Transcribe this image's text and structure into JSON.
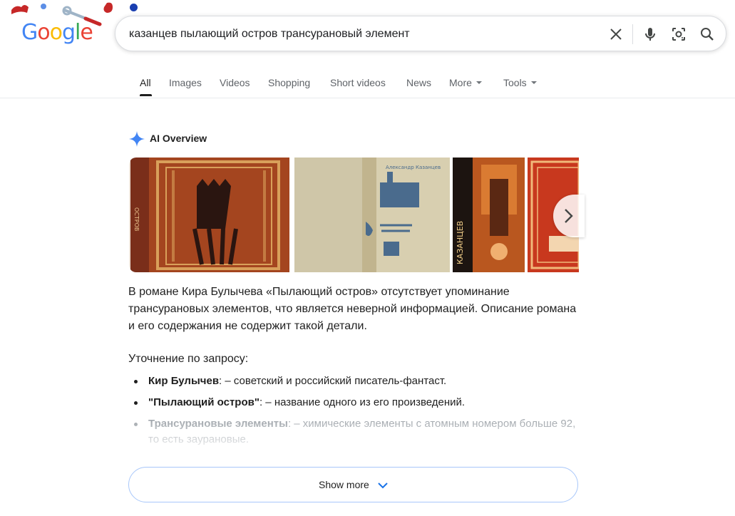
{
  "logo": {
    "letters": [
      "G",
      "o",
      "o",
      "g",
      "l",
      "e"
    ],
    "icon": "google-doodle-logo"
  },
  "search": {
    "query": "казанцев пылающий остров трансурановый элемент",
    "placeholder": ""
  },
  "search_icons": [
    "clear-icon",
    "mic-icon",
    "lens-icon",
    "search-icon"
  ],
  "tabs": [
    {
      "label": "All"
    },
    {
      "label": "Images"
    },
    {
      "label": "Videos"
    },
    {
      "label": "Shopping"
    },
    {
      "label": "Short videos"
    },
    {
      "label": "News"
    },
    {
      "label": "More"
    },
    {
      "label": "Tools"
    }
  ],
  "ai_overview": {
    "title": "AI Overview",
    "paragraph": "В романе Кира Булычева «Пылающий остров» отсутствует упоминание трансурановых элементов, что является неверной информацией. Описание романа и его содержания не содержит такой детали.",
    "clarify_heading": "Уточнение по запросу:",
    "bullets": [
      {
        "term": "Кир Булычев",
        "desc": ": – советский и российский писатель-фантаст."
      },
      {
        "term": "\"Пылающий остров\"",
        "desc": ": – название одного из его произведений."
      },
      {
        "term": "Трансурановые элементы",
        "desc": ": – химические элементы с атомным номером больше 92, то есть зaурановые."
      }
    ],
    "show_more": "Show more"
  },
  "colors": {
    "accent": "#1a73e8",
    "tab_active": "#1f1f1f",
    "muted": "#5f6368",
    "border": "#a8c7fa"
  }
}
